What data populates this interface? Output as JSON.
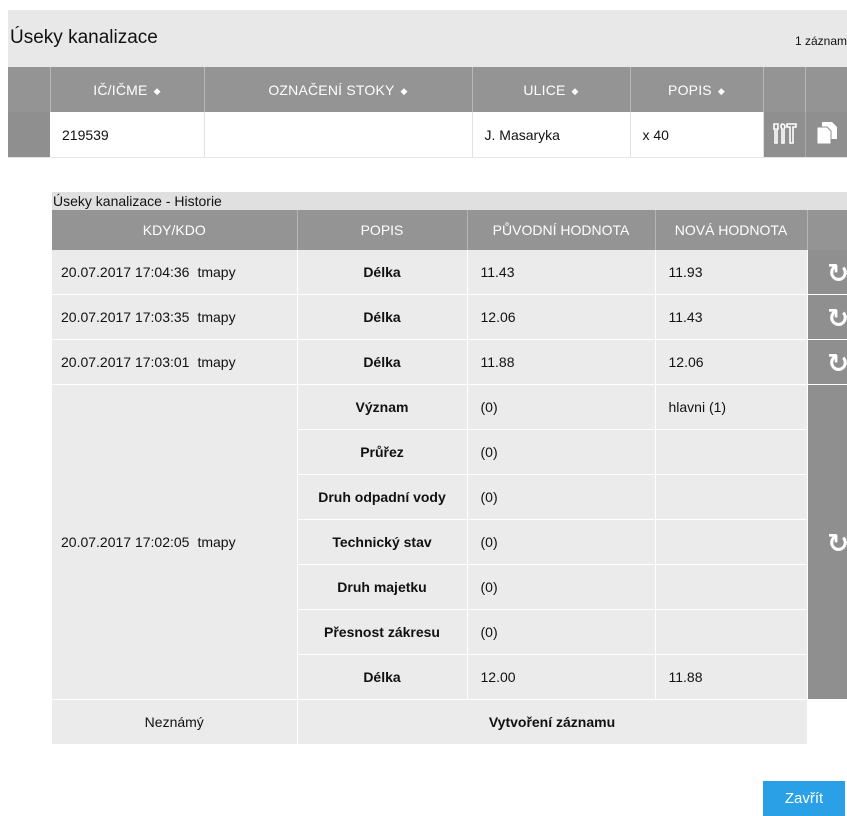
{
  "top": {
    "title": "Úseky kanalizace",
    "count": "1 záznam",
    "columns": [
      {
        "label": "IČ/IČME"
      },
      {
        "label": "OZNAČENÍ STOKY"
      },
      {
        "label": "ULICE"
      },
      {
        "label": "POPIS"
      }
    ],
    "sort_icon": "⬦",
    "row": {
      "ic": "219539",
      "oznaceni": "",
      "ulice": "J. Masaryka",
      "popis": "x 40"
    },
    "icons": [
      "tools-icon",
      "copy-icon"
    ]
  },
  "history": {
    "caption": "Úseky kanalizace - Historie",
    "columns": [
      "KDY/KDO",
      "POPIS",
      "PŮVODNÍ HODNOTA",
      "NOVÁ HODNOTA"
    ],
    "rows": [
      {
        "date": "20.07.2017 17:04:36",
        "user": "tmapy",
        "popis": "Délka",
        "old": "11.43",
        "new": "11.93"
      },
      {
        "date": "20.07.2017 17:03:35",
        "user": "tmapy",
        "popis": "Délka",
        "old": "12.06",
        "new": "11.43"
      },
      {
        "date": "20.07.2017 17:03:01",
        "user": "tmapy",
        "popis": "Délka",
        "old": "11.88",
        "new": "12.06"
      }
    ],
    "group": {
      "date": "20.07.2017 17:02:05",
      "user": "tmapy",
      "items": [
        {
          "popis": "Význam",
          "old": "(0)",
          "new": "hlavni (1)"
        },
        {
          "popis": "Průřez",
          "old": "(0)",
          "new": ""
        },
        {
          "popis": "Druh odpadní vody",
          "old": "(0)",
          "new": ""
        },
        {
          "popis": "Technický stav",
          "old": "(0)",
          "new": ""
        },
        {
          "popis": "Druh majetku",
          "old": "(0)",
          "new": ""
        },
        {
          "popis": "Přesnost zákresu",
          "old": "(0)",
          "new": ""
        },
        {
          "popis": "Délka",
          "old": "12.00",
          "new": "11.88"
        }
      ]
    },
    "creation": {
      "who": "Neznámý",
      "action": "Vytvoření záznamu"
    },
    "refresh_symbol": "↻"
  },
  "close_label": "Zavřít",
  "colors": {
    "header": "#949494",
    "accent": "#2aa1e6",
    "row_bg": "#ebebeb"
  }
}
